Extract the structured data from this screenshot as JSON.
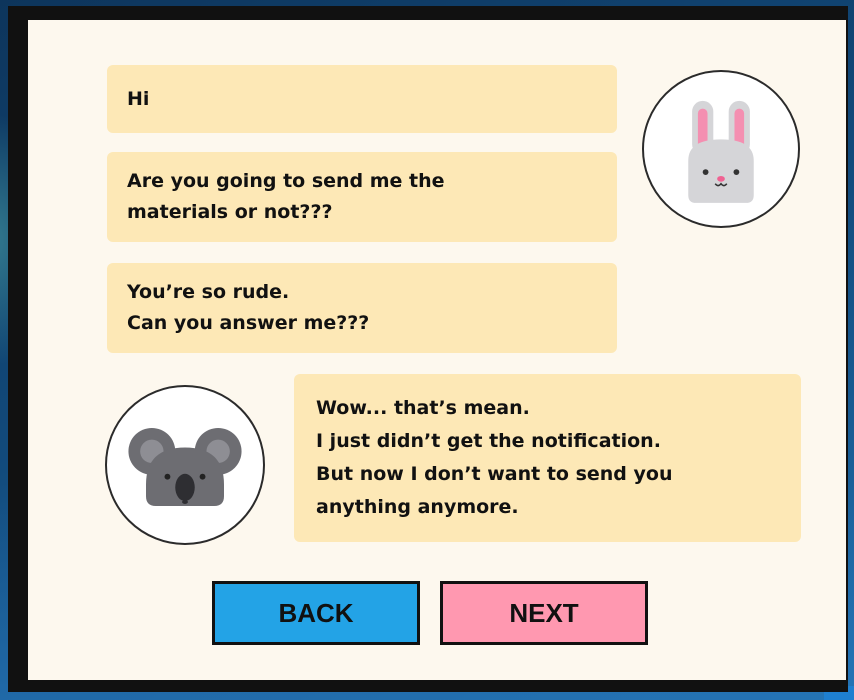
{
  "chat": {
    "messages": [
      {
        "speaker": "bunny",
        "text": "Hi"
      },
      {
        "speaker": "bunny",
        "text": "Are you going to send me the\nmaterials or not???"
      },
      {
        "speaker": "bunny",
        "text": "You’re so rude.\nCan you answer me???"
      },
      {
        "speaker": "koala",
        "text": "Wow... that’s mean.\nI just didn’t get the notification.\nBut now I don’t want to send you\nanything anymore."
      }
    ]
  },
  "avatars": {
    "bunny": {
      "icon": "bunny-icon"
    },
    "koala": {
      "icon": "koala-icon"
    }
  },
  "navigation": {
    "back_label": "BACK",
    "next_label": "NEXT"
  },
  "colors": {
    "panel_background": "#fdf8ee",
    "bubble": "#fde8b6",
    "back_button": "#23a3e6",
    "next_button": "#ff98b0",
    "frame": "#111111"
  }
}
